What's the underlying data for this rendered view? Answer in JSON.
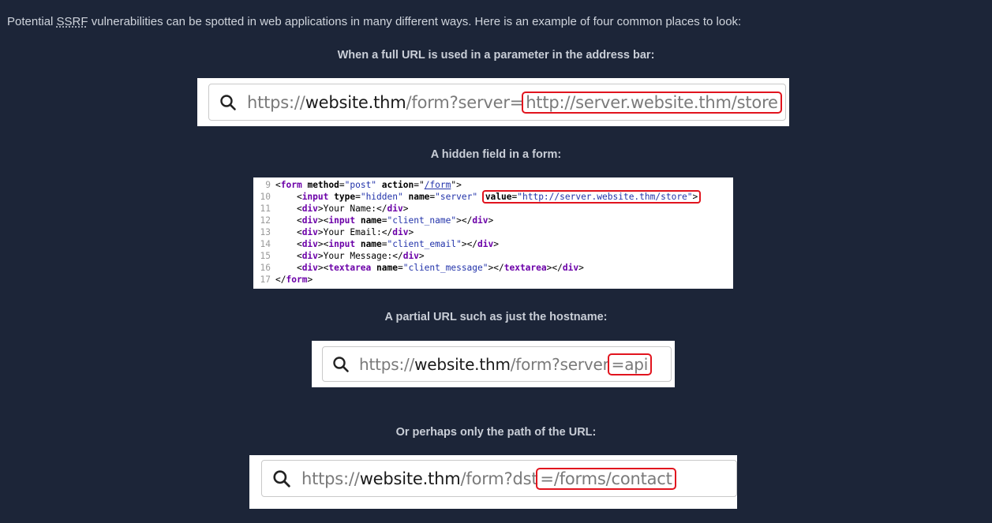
{
  "intro": {
    "before": "Potential ",
    "abbr": "SSRF",
    "after": " vulnerabilities can be spotted in web applications in many different ways. Here is an example of four common places to look:"
  },
  "examples": [
    {
      "caption": "When a full URL is used in a parameter in the address bar:",
      "url_scheme": "https://",
      "url_host": "website.thm",
      "url_path": "/form?server=",
      "url_highlight": "http://server.website.thm/store"
    },
    {
      "caption": "A hidden field in a form:"
    },
    {
      "caption": "A partial URL such as just the hostname:",
      "url_scheme": "https://",
      "url_host": "website.thm",
      "url_path": "/form?server",
      "url_highlight": "=api"
    },
    {
      "caption": "Or perhaps only the path of the URL:",
      "url_scheme": "https://",
      "url_host": "website.thm",
      "url_path": "/form?dst",
      "url_highlight": "=/forms/contact"
    }
  ],
  "code": {
    "lines": [
      "9",
      "10",
      "11",
      "12",
      "13",
      "14",
      "15",
      "16",
      "17"
    ],
    "form_tag": "form",
    "method_attr": "method",
    "method_val": "\"post\"",
    "action_attr": "action",
    "action_val": "/form",
    "input_tag": "input",
    "type_attr": "type",
    "type_val": "\"hidden\"",
    "name_attr": "name",
    "server_val": "\"server\"",
    "value_attr": "value",
    "value_val": "\"http://server.website.thm/store\"",
    "div_tag": "div",
    "your_name": "Your Name:",
    "client_name": "\"client_name\"",
    "your_email": "Your Email:",
    "client_email": "\"client_email\"",
    "your_message": "Your Message:",
    "textarea_tag": "textarea",
    "client_message": "\"client_message\""
  }
}
